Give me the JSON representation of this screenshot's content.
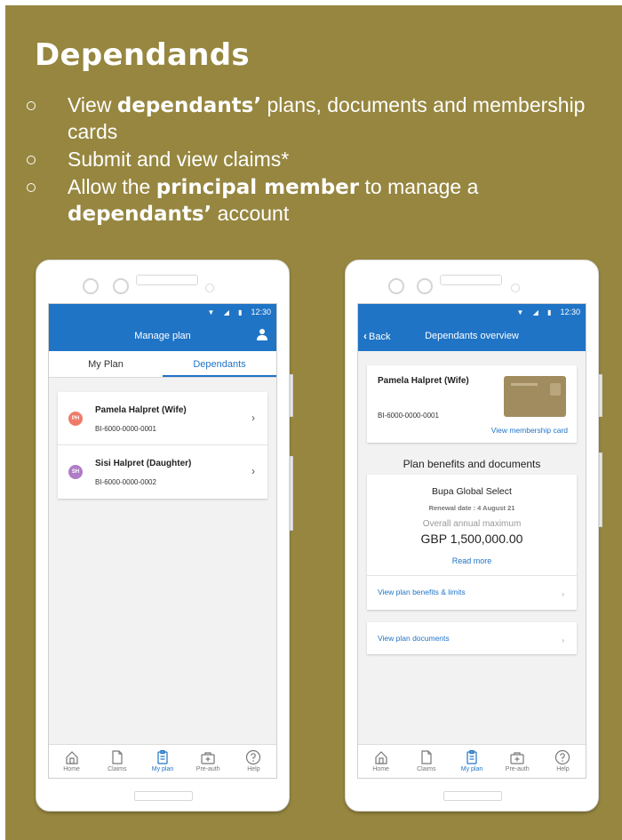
{
  "slide": {
    "title": "Dependands",
    "bullets": [
      {
        "parts": [
          {
            "t": "View ",
            "b": false
          },
          {
            "t": "dependants’",
            "b": true
          },
          {
            "t": " plans, documents and membership cards",
            "b": false
          }
        ]
      },
      {
        "parts": [
          {
            "t": "Submit and view claims*",
            "b": false
          }
        ]
      },
      {
        "parts": [
          {
            "t": "Allow the ",
            "b": false
          },
          {
            "t": "principal member",
            "b": true
          },
          {
            "t": " to manage a ",
            "b": false
          },
          {
            "t": "dependants’",
            "b": true
          },
          {
            "t": " account",
            "b": false
          }
        ]
      }
    ]
  },
  "colors": {
    "background": "#96863f",
    "accent": "#1f74c6"
  },
  "status_bar": {
    "time": "12:30"
  },
  "left_phone": {
    "header_title": "Manage plan",
    "tabs": [
      {
        "label": "My Plan",
        "active": false
      },
      {
        "label": "Dependants",
        "active": true
      }
    ],
    "dependants": [
      {
        "initials": "PH",
        "name": "Pamela Halpret (Wife)",
        "id": "BI-6000-0000-0001",
        "color": "#f07b6a"
      },
      {
        "initials": "SH",
        "name": "Sisi Halpret (Daughter)",
        "id": "BI-6000-0000-0002",
        "color": "#b07cc6"
      }
    ]
  },
  "right_phone": {
    "back_label": "Back",
    "header_title": "Dependants overview",
    "member": {
      "name": "Pamela Halpret (Wife)",
      "id": "BI-6000-0000-0001",
      "card_link": "View membership card"
    },
    "section_title": "Plan benefits and documents",
    "plan": {
      "name": "Bupa Global Select",
      "renewal": "Renewal date : 4 August 21",
      "max_label": "Overall annual maximum",
      "max_value": "GBP 1,500,000.00",
      "read_more": "Read more",
      "benefits_link": "View plan benefits & limits",
      "documents_link": "View plan documents"
    }
  },
  "bottom_nav": [
    {
      "label": "Home",
      "icon": "home-icon",
      "active": false
    },
    {
      "label": "Claims",
      "icon": "document-icon",
      "active": false
    },
    {
      "label": "My plan",
      "icon": "clipboard-icon",
      "active": true
    },
    {
      "label": "Pre-auth",
      "icon": "medical-kit-icon",
      "active": false
    },
    {
      "label": "Help",
      "icon": "help-icon",
      "active": false
    }
  ]
}
